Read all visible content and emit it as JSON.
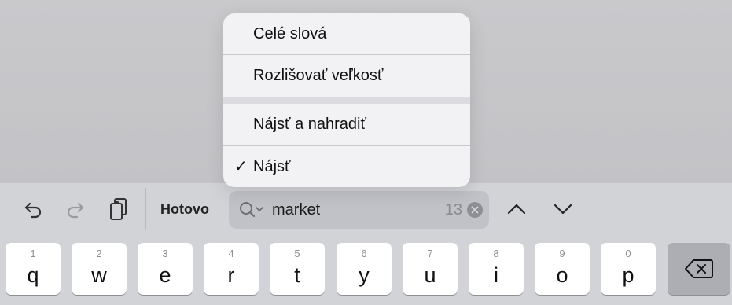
{
  "menu": {
    "items": [
      {
        "label": "Celé slová",
        "checked": false
      },
      {
        "label": "Rozlišovať veľkosť",
        "checked": false
      },
      {
        "label": "Nájsť a nahradiť",
        "checked": false
      },
      {
        "label": "Nájsť",
        "checked": true
      }
    ],
    "check_glyph": "✓"
  },
  "toolbar": {
    "undo_icon": "undo-arrow",
    "redo_icon": "redo-arrow",
    "paste_icon": "clipboard",
    "done_label": "Hotovo",
    "prev_icon": "chevron-up",
    "next_icon": "chevron-down"
  },
  "search": {
    "value": "market",
    "match_count": "13"
  },
  "keyboard": {
    "row": [
      {
        "num": "1",
        "ch": "q"
      },
      {
        "num": "2",
        "ch": "w"
      },
      {
        "num": "3",
        "ch": "e"
      },
      {
        "num": "4",
        "ch": "r"
      },
      {
        "num": "5",
        "ch": "t"
      },
      {
        "num": "6",
        "ch": "y"
      },
      {
        "num": "7",
        "ch": "u"
      },
      {
        "num": "8",
        "ch": "i"
      },
      {
        "num": "9",
        "ch": "o"
      },
      {
        "num": "0",
        "ch": "p"
      }
    ]
  }
}
